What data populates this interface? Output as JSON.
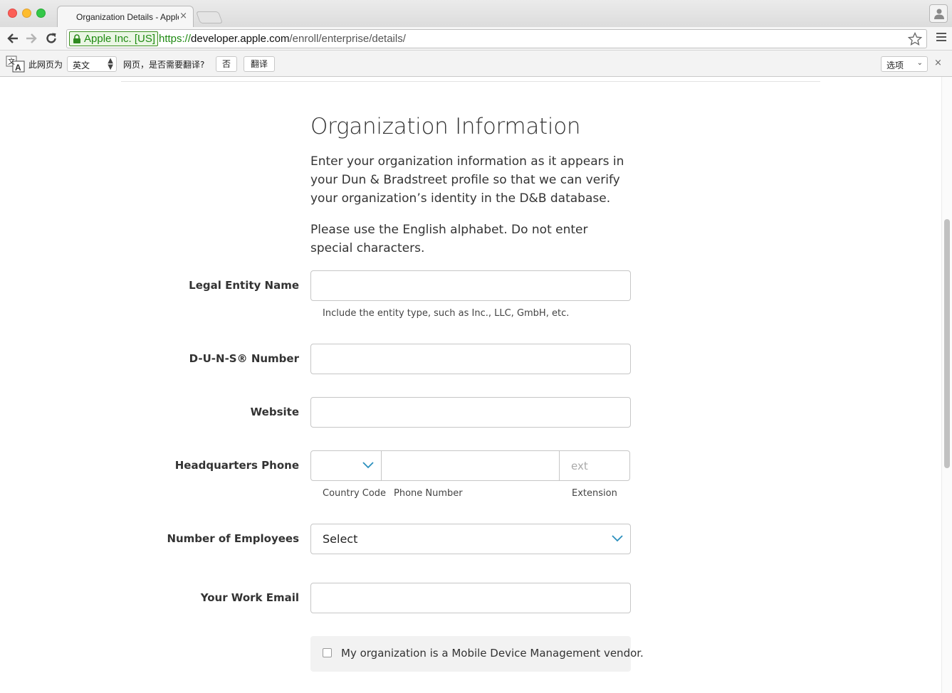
{
  "browser": {
    "tab_title": "Organization Details - Apple Developer",
    "tab_favicon": "apple-logo-icon",
    "ev_certificate": "Apple Inc. [US]",
    "url_scheme": "https://",
    "url_host": "developer.apple.com",
    "url_path": "/enroll/enterprise/details/"
  },
  "translate_bar": {
    "page_is_label": "此网页为",
    "source_language": "英文",
    "question": "网页，是否需要翻译?",
    "no_button": "否",
    "translate_button": "翻译",
    "options_label": "选项",
    "close": "×"
  },
  "form": {
    "heading": "Organization Information",
    "intro": "Enter your organization information as it appears in your Dun & Bradstreet profile so that we can verify your organization’s identity in the D&B database.",
    "alphabet_note": "Please use the English alphabet. Do not enter special characters.",
    "legal_entity_label": "Legal Entity Name",
    "legal_entity_value": "",
    "legal_entity_hint": "Include the entity type, such as Inc., LLC, GmbH, etc.",
    "duns_label": "D-U-N-S® Number",
    "duns_value": "",
    "website_label": "Website",
    "website_value": "",
    "phone_label": "Headquarters Phone",
    "phone_ext_placeholder": "ext",
    "phone_country_caption": "Country Code",
    "phone_number_caption": "Phone Number",
    "phone_ext_caption": "Extension",
    "employees_label": "Number of Employees",
    "employees_value": "Select",
    "email_label": "Your Work Email",
    "email_value": "",
    "mdm_checkbox_label": "My organization is a Mobile Device Management vendor.",
    "mdm_checked": false
  },
  "colors": {
    "ev_green": "#1f8a12",
    "chevron_blue": "#2a8fbd",
    "text": "#333333"
  }
}
